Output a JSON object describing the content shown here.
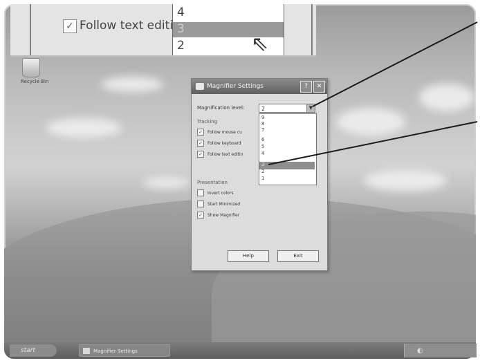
{
  "zoom_callout": {
    "checkbox_label": "Follow text editin",
    "list_options": [
      "4",
      "3",
      "2"
    ],
    "selected_option": "3"
  },
  "desktop": {
    "recycle_bin_label": "Recycle Bin"
  },
  "dialog": {
    "title": "Magnifier Settings",
    "magnification_label": "Magnification level:",
    "magnification_value": "2",
    "dropdown_options": [
      "9",
      "8",
      "7",
      "6",
      "5",
      "4",
      "3",
      "2",
      "1"
    ],
    "dropdown_selected": "3",
    "tracking": {
      "title": "Tracking",
      "items": [
        {
          "label": "Follow mouse cu",
          "checked": true
        },
        {
          "label": "Follow keyboard",
          "checked": true
        },
        {
          "label": "Follow text editin",
          "checked": true
        }
      ]
    },
    "presentation": {
      "title": "Presentation",
      "items": [
        {
          "label": "Invert colors",
          "checked": false
        },
        {
          "label": "Start Minimized",
          "checked": false
        },
        {
          "label": "Show Magnifier",
          "checked": true
        }
      ]
    },
    "help_label": "Help",
    "exit_label": "Exit"
  },
  "taskbar": {
    "start_label": "start",
    "task_button_label": "Magnifier Settings"
  },
  "colors": {
    "selection": "#9a9a9a",
    "titlebar": "#6e6e6e"
  }
}
